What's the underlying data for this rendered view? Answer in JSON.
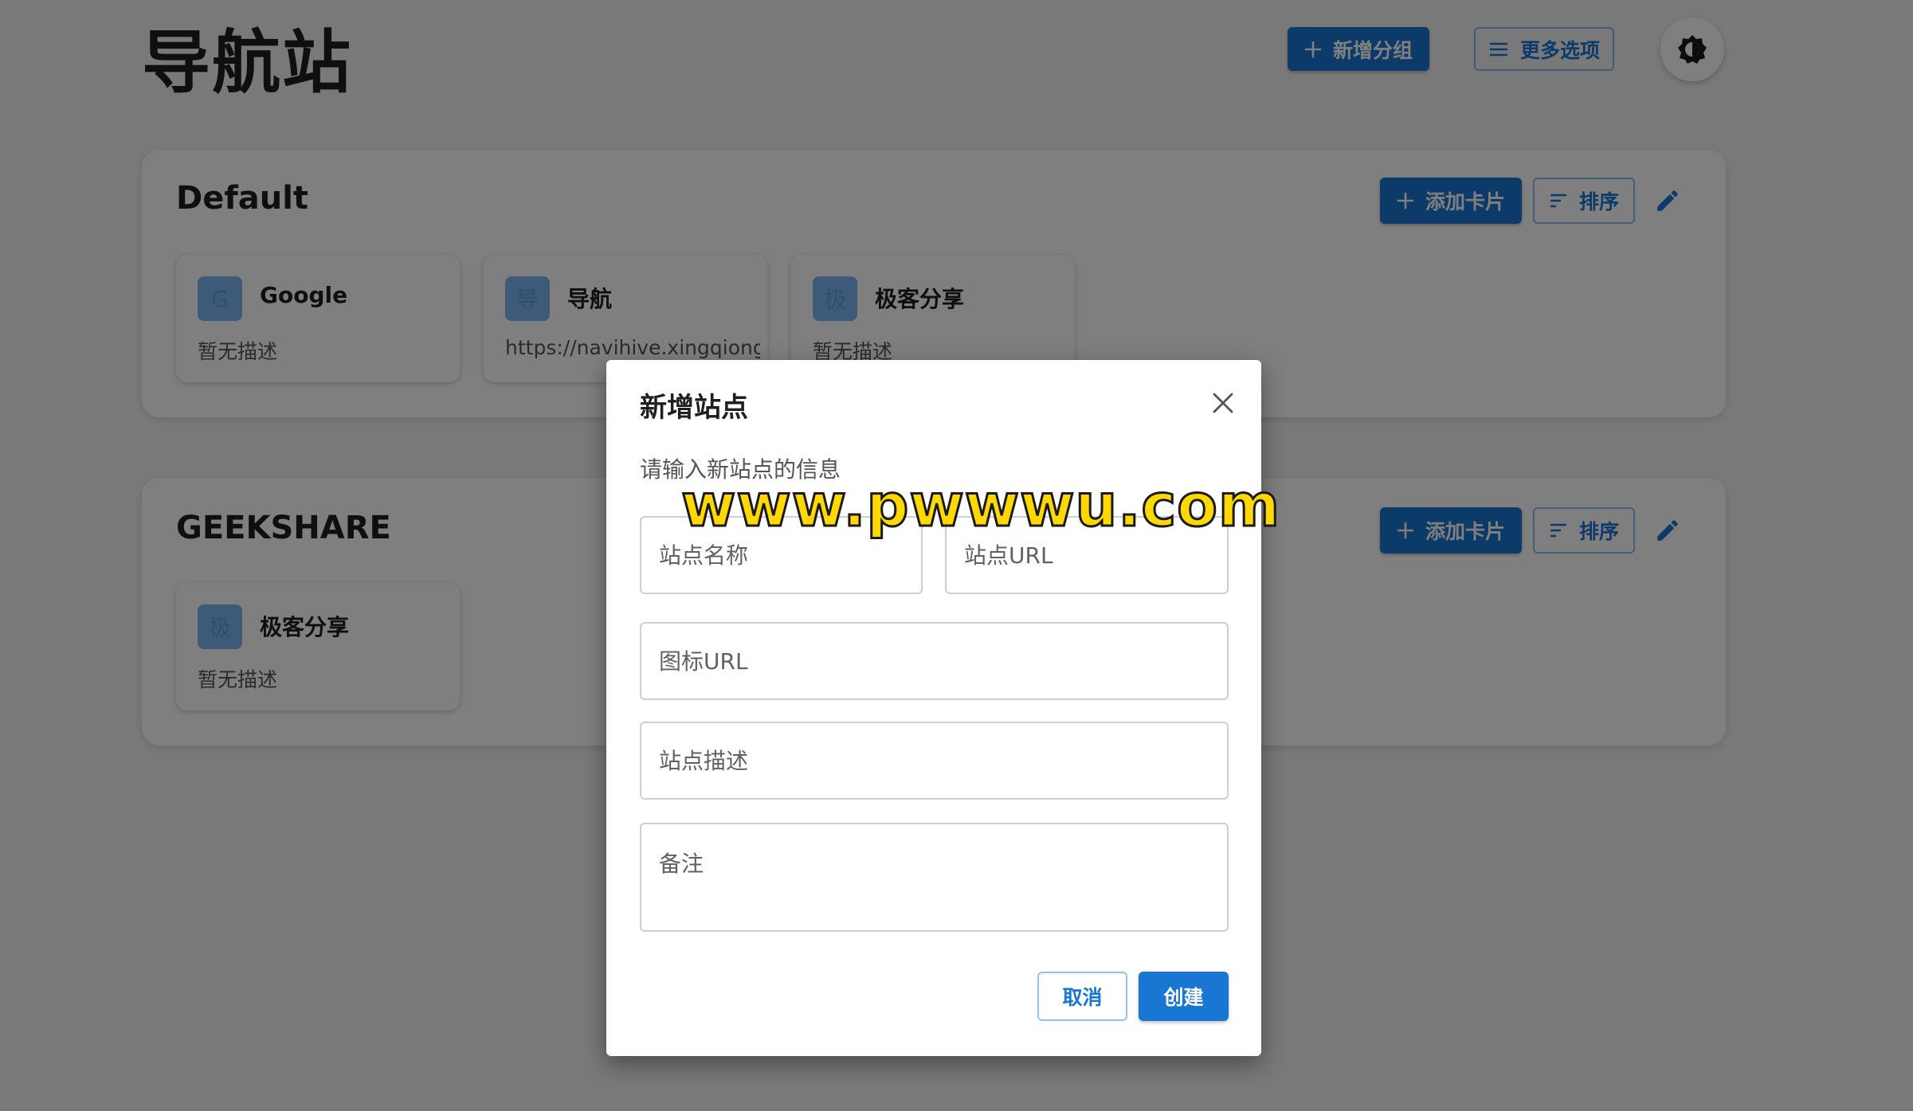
{
  "header": {
    "title": "导航站",
    "add_group_label": "新增分组",
    "more_options_label": "更多选项"
  },
  "groups": [
    {
      "title": "Default",
      "add_card_label": "添加卡片",
      "sort_label": "排序",
      "cards": [
        {
          "avatar": "G",
          "name": "Google",
          "desc": "暂无描述"
        },
        {
          "avatar": "导",
          "name": "导航",
          "desc": "https://navihive.xingqiong.i"
        },
        {
          "avatar": "极",
          "name": "极客分享",
          "desc": "暂无描述"
        }
      ]
    },
    {
      "title": "GEEKSHARE",
      "add_card_label": "添加卡片",
      "sort_label": "排序",
      "cards": [
        {
          "avatar": "极",
          "name": "极客分享",
          "desc": "暂无描述"
        }
      ]
    }
  ],
  "dialog": {
    "title": "新增站点",
    "description": "请输入新站点的信息",
    "fields": {
      "site_name": {
        "placeholder": "站点名称",
        "value": ""
      },
      "site_url": {
        "placeholder": "站点URL",
        "value": ""
      },
      "icon_url": {
        "placeholder": "图标URL",
        "value": ""
      },
      "site_desc": {
        "placeholder": "站点描述",
        "value": ""
      },
      "notes": {
        "placeholder": "备注",
        "value": ""
      }
    },
    "cancel_label": "取消",
    "create_label": "创建"
  },
  "watermark": "www.pwwwu.com",
  "colors": {
    "primary": "#1976d2",
    "avatar": "#7cb4f2",
    "background": "#f2f3f5"
  },
  "icons": {
    "add": "plus-icon",
    "more": "menu-icon",
    "theme": "brightness-icon",
    "sort": "sort-icon",
    "edit": "pencil-icon",
    "close": "close-icon"
  }
}
